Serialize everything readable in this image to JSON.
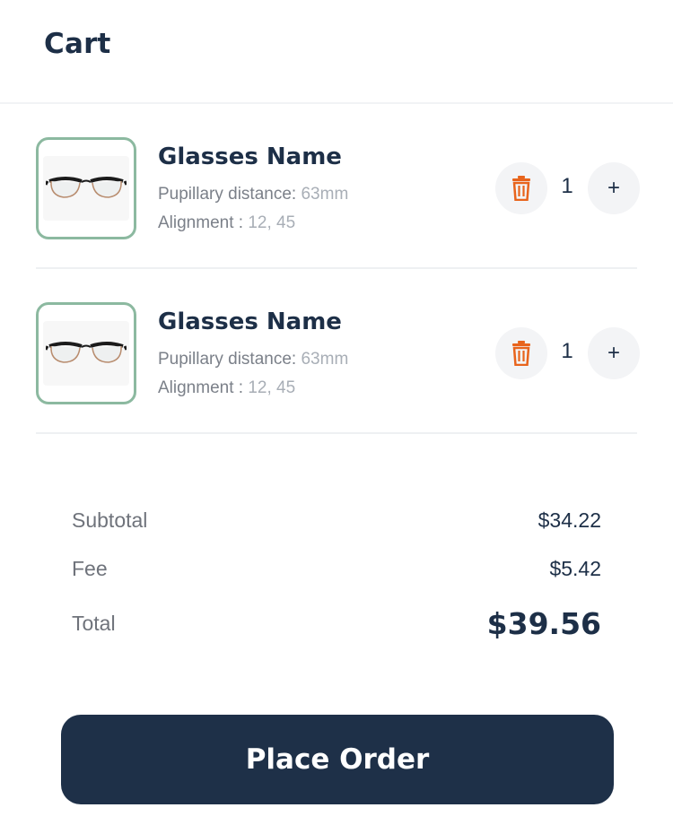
{
  "header": {
    "title": "Cart"
  },
  "items": [
    {
      "name": "Glasses Name",
      "pd_label": "Pupillary distance:",
      "pd_value": "63mm",
      "align_label": "Alignment :",
      "align_value": "12, 45",
      "quantity": "1",
      "add_label": "+"
    },
    {
      "name": "Glasses Name",
      "pd_label": "Pupillary distance:",
      "pd_value": "63mm",
      "align_label": "Alignment :",
      "align_value": "12, 45",
      "quantity": "1",
      "add_label": "+"
    }
  ],
  "summary": {
    "subtotal_label": "Subtotal",
    "subtotal_value": "$34.22",
    "fee_label": "Fee",
    "fee_value": "$5.42",
    "total_label": "Total",
    "total_value": "$39.56"
  },
  "actions": {
    "place_order_label": "Place Order"
  },
  "icons": {
    "delete": "trash-icon",
    "product": "eyeglasses-image"
  },
  "colors": {
    "primary": "#1e3048",
    "delete_accent": "#e8641c",
    "thumb_border": "#8cb9a0"
  }
}
